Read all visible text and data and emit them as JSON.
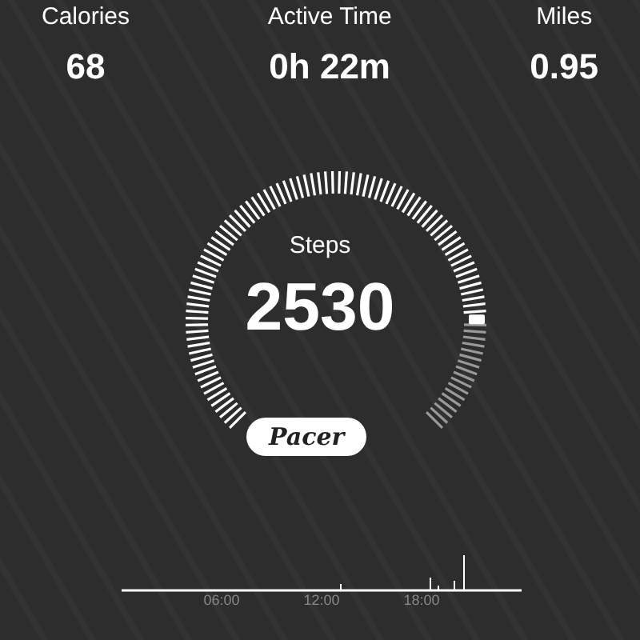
{
  "stats": [
    {
      "label": "Calories",
      "value": "68"
    },
    {
      "label": "Active Time",
      "value": "0h 22m"
    },
    {
      "label": "Miles",
      "value": "0.95"
    }
  ],
  "steps": {
    "label": "Steps",
    "value": "2530"
  },
  "logo": {
    "text": "Pacer"
  },
  "timeline": {
    "labels": [
      "06:00",
      "12:00",
      "18:00"
    ]
  }
}
